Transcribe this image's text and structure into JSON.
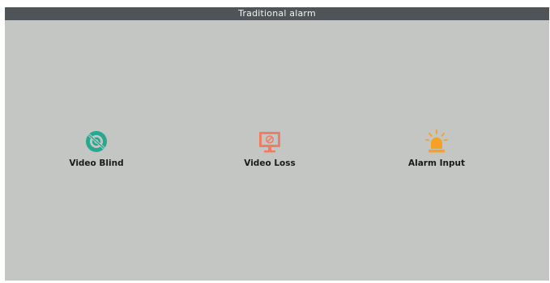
{
  "window": {
    "title": "Traditional alarm"
  },
  "colors": {
    "titlebar_bg": "#4e5458",
    "panel_bg": "#c4c6c4",
    "video_blind": "#27a88f",
    "video_loss": "#ee7d62",
    "alarm_input": "#f6a024"
  },
  "tiles": [
    {
      "label": "Video Blind",
      "icon": "eye-blocked-icon"
    },
    {
      "label": "Video Loss",
      "icon": "monitor-no-signal-icon"
    },
    {
      "label": "Alarm Input",
      "icon": "alarm-siren-icon"
    }
  ]
}
